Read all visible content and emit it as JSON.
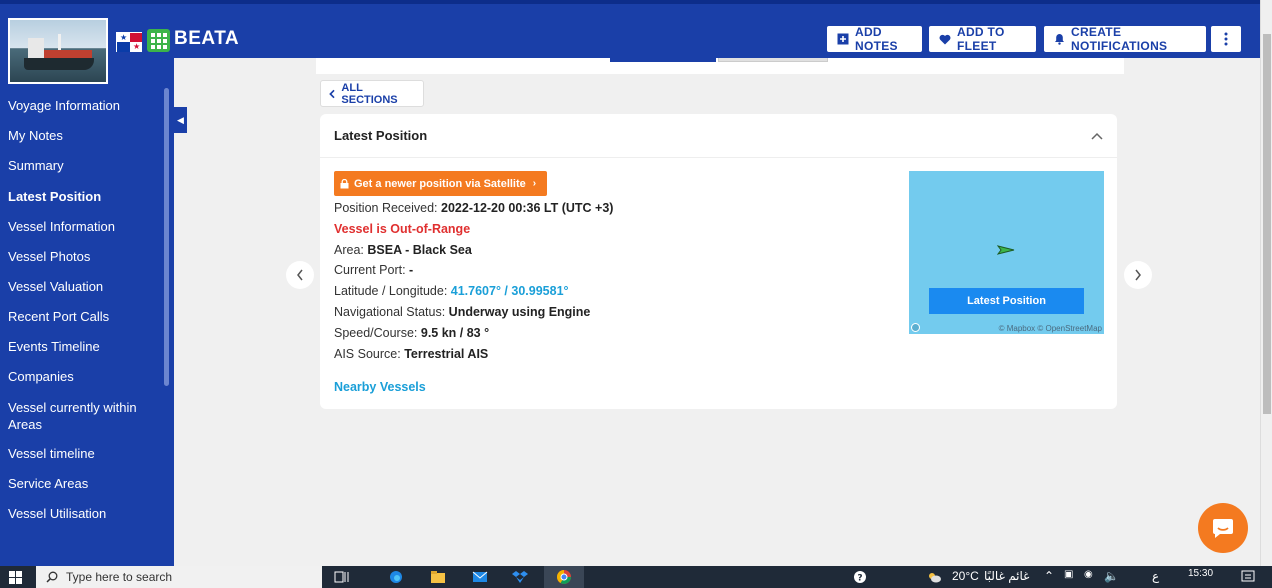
{
  "vessel": {
    "name": "BEATA"
  },
  "header": {
    "add_notes": "ADD NOTES",
    "add_to_fleet": "ADD TO FLEET",
    "create_notifications": "CREATE NOTIFICATIONS"
  },
  "sidebar": {
    "items": [
      {
        "label": "Voyage Information",
        "active": false
      },
      {
        "label": "My Notes",
        "active": false
      },
      {
        "label": "Summary",
        "active": false
      },
      {
        "label": "Latest Position",
        "active": true
      },
      {
        "label": "Vessel Information",
        "active": false
      },
      {
        "label": "Vessel Photos",
        "active": false
      },
      {
        "label": "Vessel Valuation",
        "active": false
      },
      {
        "label": "Recent Port Calls",
        "active": false
      },
      {
        "label": "Events Timeline",
        "active": false
      },
      {
        "label": "Companies",
        "active": false
      },
      {
        "label": "Vessel currently within Areas",
        "active": false
      },
      {
        "label": "Vessel timeline",
        "active": false
      },
      {
        "label": "Service Areas",
        "active": false
      },
      {
        "label": "Vessel Utilisation",
        "active": false
      }
    ]
  },
  "main": {
    "all_sections": "ALL SECTIONS",
    "card_title": "Latest Position",
    "satellite_button": "Get a newer position via Satellite",
    "fields": {
      "position_received_label": "Position Received:",
      "position_received_value": "2022-12-20 00:36 LT (UTC +3)",
      "range_status": "Vessel is Out-of-Range",
      "area_label": "Area:",
      "area_value": "BSEA - Black Sea",
      "current_port_label": "Current Port:",
      "current_port_value": "-",
      "latlon_label": "Latitude / Longitude:",
      "latlon_value": "41.7607° / 30.99581°",
      "nav_status_label": "Navigational Status:",
      "nav_status_value": "Underway using Engine",
      "speed_course_label": "Speed/Course:",
      "speed_course_value": "9.5 kn / 83 °",
      "ais_source_label": "AIS Source:",
      "ais_source_value": "Terrestrial AIS"
    },
    "nearby_vessels": "Nearby Vessels",
    "map": {
      "button": "Latest Position",
      "attribution": "© Mapbox © OpenStreetMap"
    }
  },
  "taskbar": {
    "search_placeholder": "Type here to search",
    "temperature": "20°C",
    "weather_text": "غائم غالبًا",
    "time": "15:30",
    "lang": "ع"
  },
  "colors": {
    "brand_blue": "#1a3fa8",
    "accent_orange": "#f47a20",
    "link_blue": "#1a9fd8",
    "alert_red": "#e03030",
    "map_water": "#73cbee"
  }
}
